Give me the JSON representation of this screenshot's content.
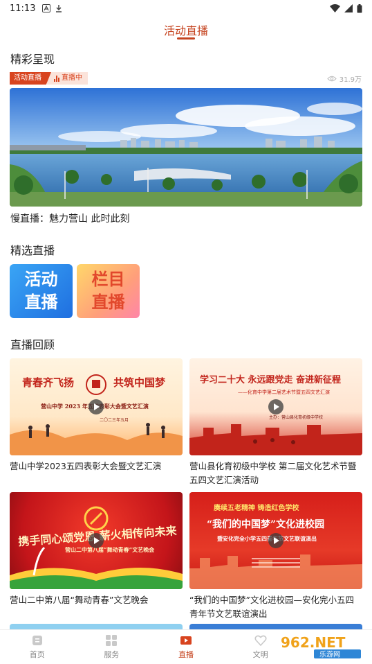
{
  "status_bar": {
    "time": "11:13"
  },
  "header": {
    "title": "活动直播"
  },
  "sections": {
    "highlights": "精彩呈现",
    "selected": "精选直播",
    "replays": "直播回顾"
  },
  "featured": {
    "tag_live": "活动直播",
    "tag_status": "直播中",
    "views": "31.9万",
    "caption": "慢直播：魅力营山 此时此刻"
  },
  "categories": [
    {
      "line1": "活动",
      "line2": "直播"
    },
    {
      "line1": "栏目",
      "line2": "直播"
    }
  ],
  "replays": [
    {
      "title": "营山中学2023五四表彰大会暨文艺汇演",
      "thumb_text_1": "青春齐飞扬",
      "thumb_text_2": "共筑中国梦",
      "thumb_text_3": "营山中学 2023 年五四表彰大会暨文艺汇演",
      "thumb_text_4": "二〇二三年五月"
    },
    {
      "title": "营山县化育初级中学校 第二届文化艺术节暨五四文艺汇演活动",
      "thumb_text_1": "学习二十大 永远跟党走 奋进新征程",
      "thumb_text_2": "——化育中学第二届艺术节暨五四文艺汇演",
      "thumb_text_3": "主办：营山县化育初级中学校"
    },
    {
      "title": "营山二中第八届“舞动青春”文艺晚会",
      "thumb_text_1": "携手同心颂党恩 薪火相传向未来",
      "thumb_text_2": "营山二中第八届“舞动青春”文艺晚会"
    },
    {
      "title": "“我们的中国梦”文化进校园—安化完小五四青年节文艺联谊演出",
      "thumb_text_1": "赓续五老精神 铸造红色学校",
      "thumb_text_2": "“我们的中国梦”文化进校园",
      "thumb_text_3": "暨安化完全小学五四青年节文艺联谊演出"
    }
  ],
  "bottom_nav": [
    {
      "label": "首页",
      "icon": "home-icon"
    },
    {
      "label": "服务",
      "icon": "grid-icon"
    },
    {
      "label": "直播",
      "icon": "live-video-icon"
    },
    {
      "label": "文明",
      "icon": "heart-icon"
    }
  ],
  "watermark": {
    "text": "962.NET",
    "subtext": "乐游网"
  },
  "colors": {
    "accent": "#c5431f",
    "live_tag": "#d8441f"
  }
}
